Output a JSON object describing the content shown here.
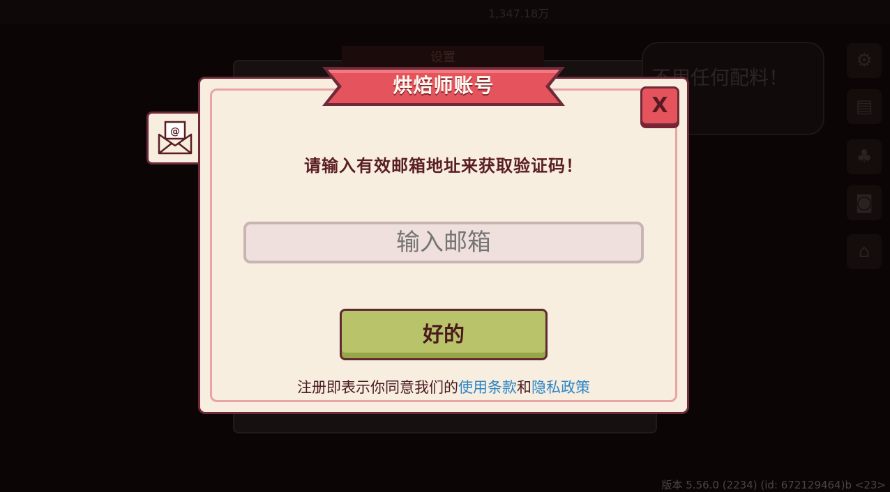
{
  "dialog": {
    "title": "烘焙师账号",
    "close_label": "X",
    "prompt": "请输入有效邮箱地址来获取验证码！",
    "email_placeholder": "输入邮箱",
    "email_value": "",
    "ok_label": "好的",
    "terms_prefix": "注册即表示你同意我们的",
    "terms_link": "使用条款",
    "terms_and": "和",
    "privacy_link": "隐私政策"
  },
  "background": {
    "settings_title": "设置",
    "top_value_1": "1,347.18万",
    "speech_text": "不用任何配料！"
  },
  "version_text": "版本 5.56.0 (2234) (id: 672129464)b <23>",
  "colors": {
    "dialog_bg": "#f7eee0",
    "border": "#6e2a38",
    "ribbon": "#e5535c",
    "ok_button": "#b9c46a",
    "link": "#2d86c8"
  },
  "icons": [
    "mail-icon",
    "close-icon",
    "gear-icon",
    "book-icon",
    "plant-icon",
    "camera-icon",
    "home-icon"
  ]
}
